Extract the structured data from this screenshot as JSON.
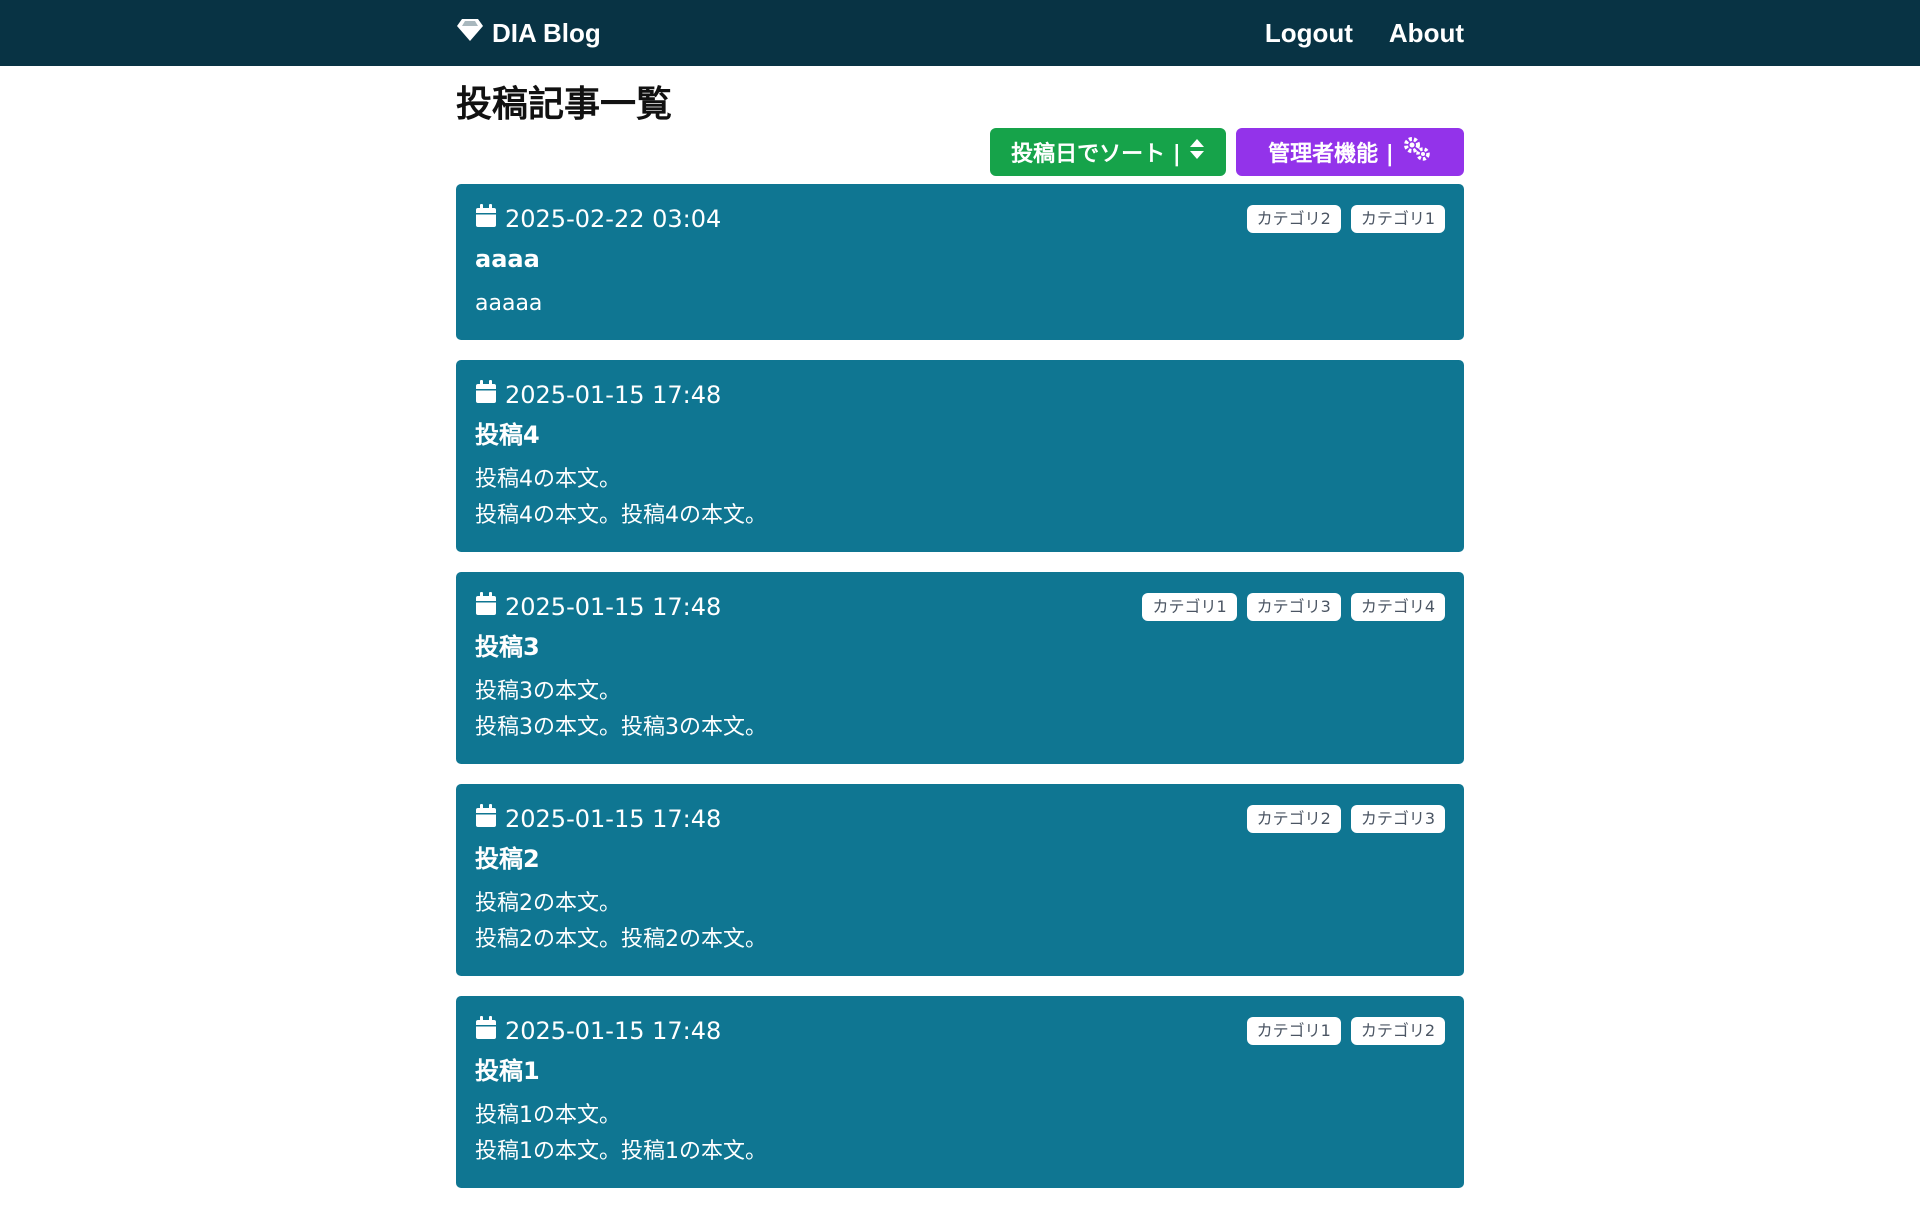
{
  "nav": {
    "brand": "DIA Blog",
    "links": [
      "Logout",
      "About"
    ]
  },
  "page": {
    "title": "投稿記事一覧",
    "sort_button": "投稿日でソート |",
    "admin_button": "管理者機能 |"
  },
  "posts": [
    {
      "date": "2025-02-22 03:04",
      "title": "aaaa",
      "body": [
        "aaaaa"
      ],
      "tags": [
        "カテゴリ2",
        "カテゴリ1"
      ]
    },
    {
      "date": "2025-01-15 17:48",
      "title": "投稿4",
      "body": [
        "投稿4の本文。",
        "投稿4の本文。投稿4の本文。"
      ],
      "tags": []
    },
    {
      "date": "2025-01-15 17:48",
      "title": "投稿3",
      "body": [
        "投稿3の本文。",
        "投稿3の本文。投稿3の本文。"
      ],
      "tags": [
        "カテゴリ1",
        "カテゴリ3",
        "カテゴリ4"
      ]
    },
    {
      "date": "2025-01-15 17:48",
      "title": "投稿2",
      "body": [
        "投稿2の本文。",
        "投稿2の本文。投稿2の本文。"
      ],
      "tags": [
        "カテゴリ2",
        "カテゴリ3"
      ]
    },
    {
      "date": "2025-01-15 17:48",
      "title": "投稿1",
      "body": [
        "投稿1の本文。",
        "投稿1の本文。投稿1の本文。"
      ],
      "tags": [
        "カテゴリ1",
        "カテゴリ2"
      ]
    }
  ],
  "colors": {
    "navbar": "#083344",
    "card": "#0f7692",
    "sort_button": "#16a34a",
    "admin_button": "#9333ea"
  },
  "icons": {
    "brand": "gem-icon",
    "date": "calendar-icon",
    "sort": "sort-icon",
    "admin": "gears-icon"
  }
}
